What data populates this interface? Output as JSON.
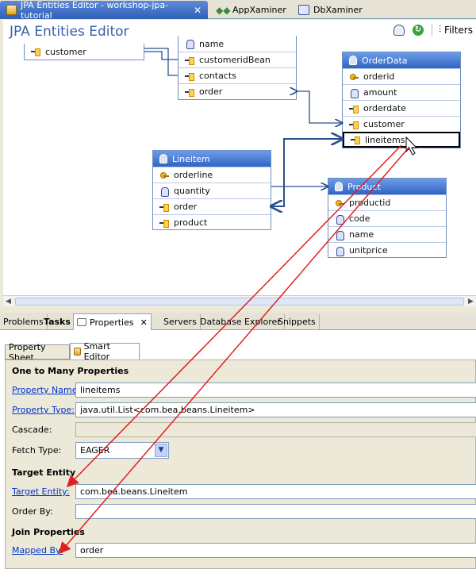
{
  "editor_tabs": [
    {
      "label": "JPA Entities Editor - workshop-jpa-tutorial",
      "icon": "jpa-editor-icon"
    },
    {
      "label": "AppXaminer",
      "icon": "appxaminer-icon"
    },
    {
      "label": "DbXaminer",
      "icon": "dbxaminer-icon"
    }
  ],
  "editor": {
    "title": "JPA Entities Editor",
    "filters_label": "Filters"
  },
  "entities": {
    "customer_fragment": {
      "fields": [
        "customer"
      ]
    },
    "customer_block": {
      "fields": [
        "name",
        "customeridBean",
        "contacts",
        "order"
      ]
    },
    "orderdata": {
      "name": "OrderData",
      "fields": [
        "orderid",
        "amount",
        "orderdate",
        "customer",
        "lineitems"
      ]
    },
    "lineitem": {
      "name": "Lineitem",
      "fields": [
        "orderline",
        "quantity",
        "order",
        "product"
      ]
    },
    "product": {
      "name": "Product",
      "fields": [
        "productid",
        "code",
        "name",
        "unitprice"
      ]
    }
  },
  "view_tabs": [
    "Problems",
    "Tasks",
    "Properties",
    "Servers",
    "Database Explorer",
    "Snippets"
  ],
  "subtabs": [
    "Property Sheet",
    "Smart Editor"
  ],
  "form": {
    "section_one_to_many": "One to Many Properties",
    "property_name_label": "Property Name:",
    "property_name_value": "lineitems",
    "property_type_label": "Property Type:",
    "property_type_value": "java.util.List<com.bea.beans.Lineitem>",
    "cascade_label": "Cascade:",
    "fetch_type_label": "Fetch Type:",
    "fetch_type_value": "EAGER",
    "section_target_entity": "Target Entity",
    "target_entity_label": "Target Entity:",
    "target_entity_value": "com.bea.beans.Lineitem",
    "order_by_label": "Order By:",
    "section_join": "Join Properties",
    "mapped_by_label": "Mapped By:",
    "mapped_by_value": "order"
  },
  "colors": {
    "accent": "#2f64c4",
    "annotation_arrow": "#e02020",
    "link": "#0033cc"
  }
}
